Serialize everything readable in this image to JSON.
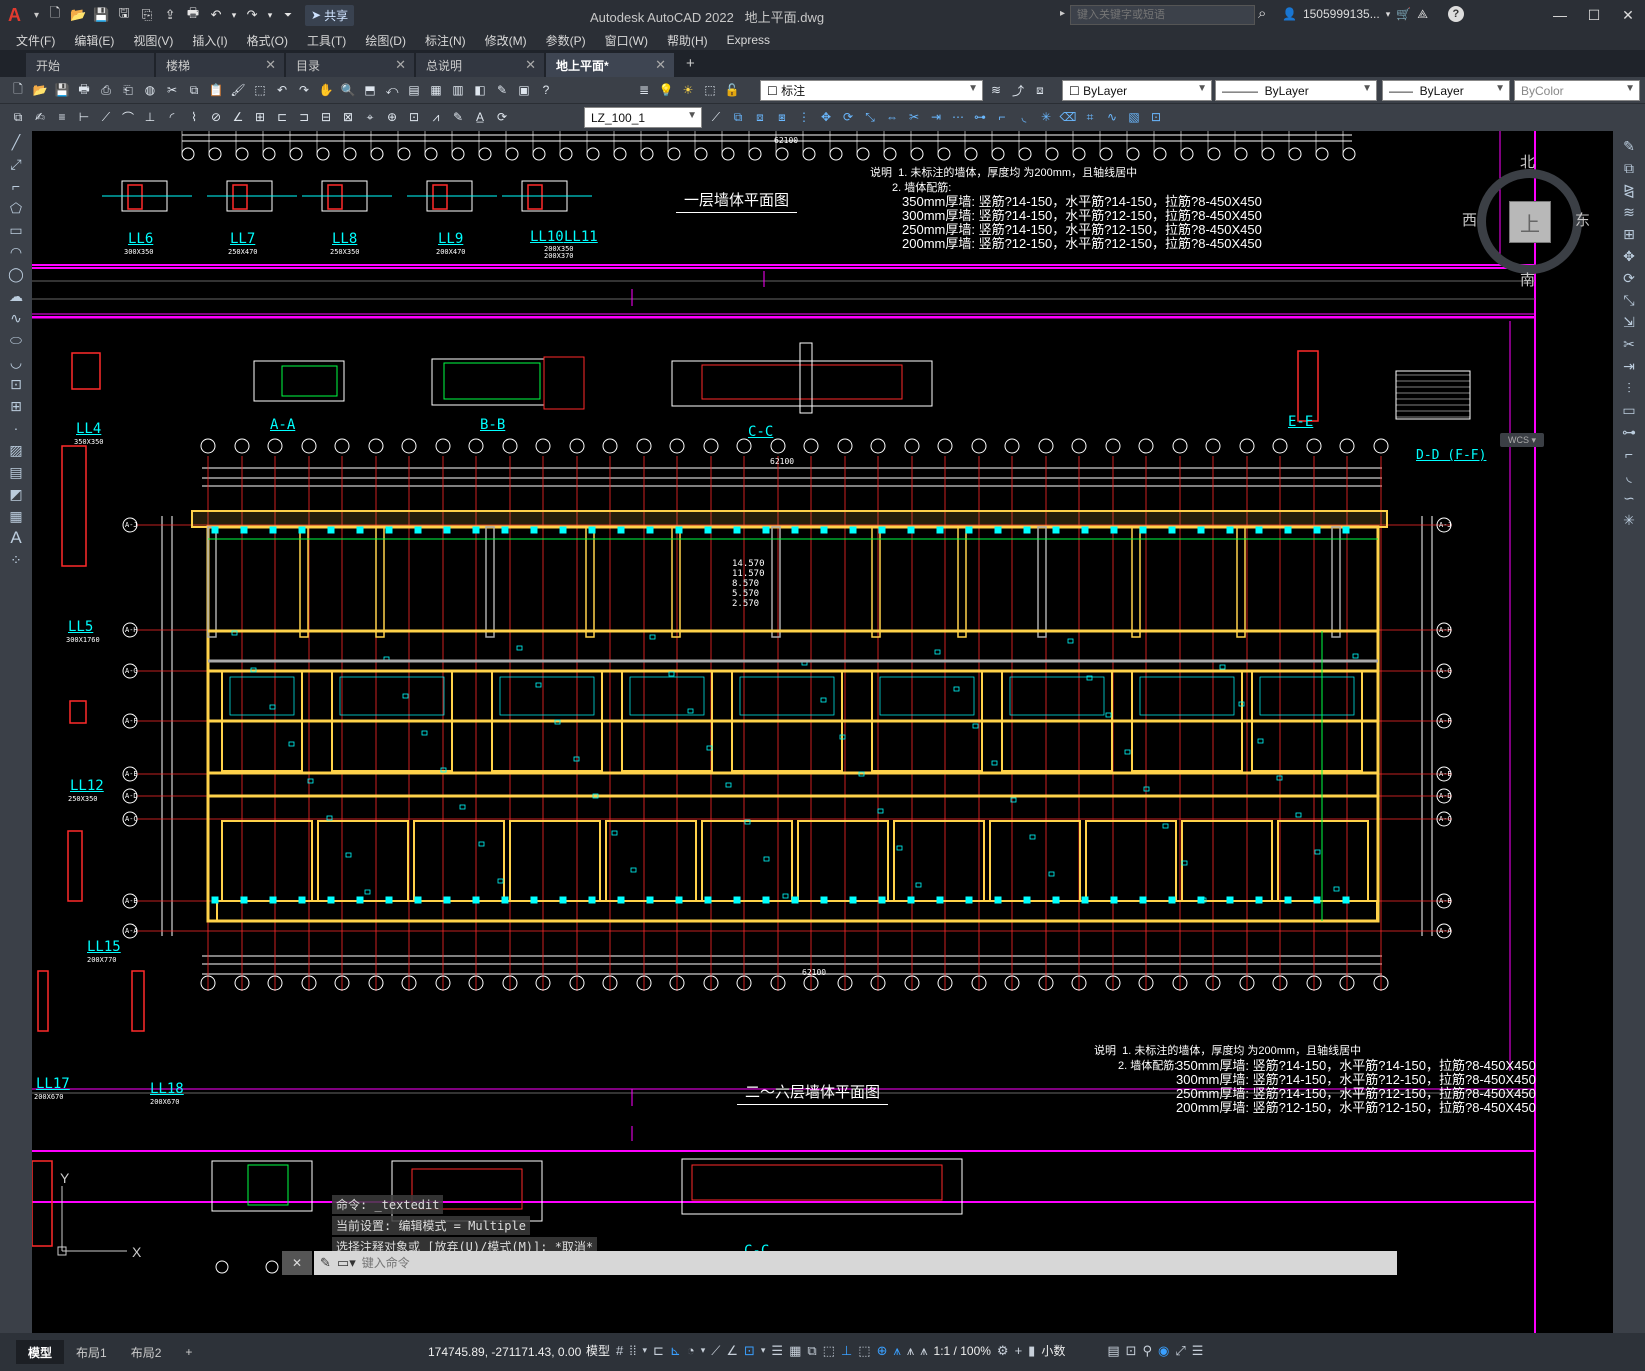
{
  "app": {
    "title": "Autodesk AutoCAD 2022",
    "document": "地上平面.dwg",
    "share_label": "共享",
    "search_placeholder": "键入关键字或短语",
    "user_name": "1505999135..."
  },
  "menu": [
    "文件(F)",
    "编辑(E)",
    "视图(V)",
    "插入(I)",
    "格式(O)",
    "工具(T)",
    "绘图(D)",
    "标注(N)",
    "修改(M)",
    "参数(P)",
    "窗口(W)",
    "帮助(H)",
    "Express"
  ],
  "file_tabs": [
    {
      "label": "开始",
      "active": false
    },
    {
      "label": "楼梯",
      "active": false
    },
    {
      "label": "目录",
      "active": false
    },
    {
      "label": "总说明",
      "active": false
    },
    {
      "label": "地上平面*",
      "active": true
    }
  ],
  "toolbar": {
    "layer": "标注",
    "color": "ByLayer",
    "linetype": "ByLayer",
    "lineweight": "ByLayer",
    "plotstyle": "ByColor",
    "block_name": "LZ_100_1"
  },
  "viewcube": {
    "north": "北",
    "south": "南",
    "east": "东",
    "west": "西",
    "face": "上",
    "wcs": "WCS"
  },
  "drawing": {
    "upper_plan_title": "一层墙体平面图",
    "main_plan_title": "二～六层墙体平面图",
    "overall_dim": "62100",
    "notes_heading": "说明",
    "note1": "1. 未标注的墙体，厚度均        为200mm，且轴线居中",
    "note2": "2. 墙体配筋:",
    "wall_specs": [
      "350mm厚墙: 竖筋?14-150，水平筋?14-150，拉筋?8-450X450",
      "300mm厚墙: 竖筋?14-150，水平筋?12-150，拉筋?8-450X450",
      "250mm厚墙: 竖筋?14-150，水平筋?12-150，拉筋?8-450X450",
      "200mm厚墙: 竖筋?12-150，水平筋?12-150，拉筋?8-450X450"
    ],
    "beam_labels": [
      "LL6",
      "LL7",
      "LL8",
      "LL9",
      "LL10",
      "LL11",
      "LL4",
      "LL5",
      "LL12",
      "LL15",
      "LL17",
      "LL18"
    ],
    "beam_sizes": [
      "300X350",
      "250X470",
      "250X350",
      "200X470",
      "200X350",
      "200X370",
      "350X350",
      "300X1760",
      "250X350",
      "200X770",
      "200X670",
      "200X670"
    ],
    "sections": [
      "A-A",
      "B-B",
      "C-C",
      "E-E",
      "D-D (F-F)"
    ],
    "row_axes": [
      "A-J",
      "A-H",
      "A-G",
      "A-F",
      "A-E",
      "A-D",
      "A-C",
      "A-B",
      "A-A"
    ],
    "elevations": [
      "14.570",
      "11.570",
      "8.570",
      "5.570",
      "2.570"
    ]
  },
  "command": {
    "history": [
      "命令: _textedit",
      "当前设置: 编辑模式 = Multiple",
      "选择注释对象或 [放弃(U)/模式(M)]: *取消*"
    ],
    "placeholder": "键入命令"
  },
  "status": {
    "layouts": [
      {
        "label": "模型",
        "active": true
      },
      {
        "label": "布局1",
        "active": false
      },
      {
        "label": "布局2",
        "active": false
      }
    ],
    "coords": "174745.89, -271171.43, 0.00",
    "mode": "模型",
    "scale": "1:1 / 100%",
    "units": "小数"
  },
  "colors": {
    "wall": "#ffd24a",
    "axis": "#ff2a2a",
    "dim": "#ffffff",
    "frame": "#ff00ff",
    "column": "#00ffff",
    "grey": "#aaaaaa",
    "green": "#00ff44"
  }
}
